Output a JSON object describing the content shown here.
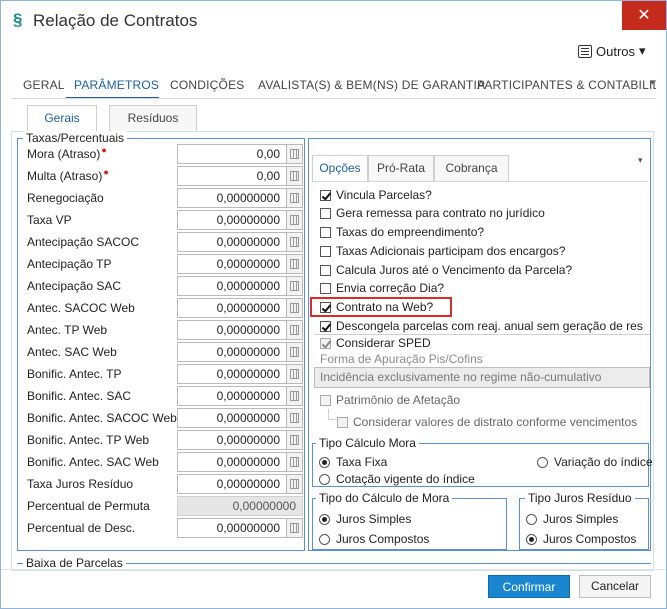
{
  "window": {
    "title": "Relação de Contratos",
    "close_glyph": "✕"
  },
  "toolbar": {
    "outros_label": "Outros",
    "outros_caret": "▾"
  },
  "main_tabs": [
    {
      "label": "GERAL"
    },
    {
      "label": "PARÂMETROS"
    },
    {
      "label": "CONDIÇÕES"
    },
    {
      "label": "AVALISTA(S) & BEM(NS) DE GARANTIA"
    },
    {
      "label": "PARTICIPANTES & CONTABILIDADE"
    }
  ],
  "sub_tabs": [
    {
      "label": "Gerais"
    },
    {
      "label": "Resíduos"
    }
  ],
  "taxas": {
    "legend": "Taxas/Percentuais",
    "fields": [
      {
        "label": "Mora (Atraso)",
        "required": true,
        "value": "0,00"
      },
      {
        "label": "Multa (Atraso)",
        "required": true,
        "value": "0,00"
      },
      {
        "label": "Renegociação",
        "value": "0,00000000"
      },
      {
        "label": "Taxa VP",
        "value": "0,00000000"
      },
      {
        "label": "Antecipação SACOC",
        "value": "0,00000000"
      },
      {
        "label": "Antecipação TP",
        "value": "0,00000000"
      },
      {
        "label": "Antecipação SAC",
        "value": "0,00000000"
      },
      {
        "label": "Antec. SACOC Web",
        "value": "0,00000000"
      },
      {
        "label": "Antec. TP Web",
        "value": "0,00000000"
      },
      {
        "label": "Antec. SAC Web",
        "value": "0,00000000"
      },
      {
        "label": "Bonific. Antec. TP",
        "value": "0,00000000"
      },
      {
        "label": "Bonific. Antec. SAC",
        "value": "0,00000000"
      },
      {
        "label": "Bonific. Antec. SACOC Web",
        "value": "0,00000000"
      },
      {
        "label": "Bonific. Antec. TP Web",
        "value": "0,00000000"
      },
      {
        "label": "Bonific. Antec. SAC Web",
        "value": "0,00000000"
      },
      {
        "label": "Taxa Juros Resíduo",
        "value": "0,00000000"
      },
      {
        "label": "Percentual de Permuta",
        "value": "0,00000000"
      },
      {
        "label": "Percentual de Desc.",
        "value": "0,00000000"
      }
    ]
  },
  "baixa_legend": "Baixa de Parcelas",
  "opt_tabs": [
    {
      "label": "Opções"
    },
    {
      "label": "Pró-Rata"
    },
    {
      "label": "Cobrança"
    }
  ],
  "options": [
    {
      "label": "Vincula Parcelas?",
      "checked": true
    },
    {
      "label": "Gera remessa para contrato no jurídico",
      "checked": false
    },
    {
      "label": "Taxas do empreendimento?",
      "checked": false
    },
    {
      "label": "Taxas Adicionais participam dos encargos?",
      "checked": false
    },
    {
      "label": "Calcula Juros até o Vencimento da Parcela?",
      "checked": false
    },
    {
      "label": "Envia correção Dia?",
      "checked": false
    },
    {
      "label": "Contrato na Web?",
      "checked": true
    },
    {
      "label": "Descongela parcelas com reaj. anual sem geração de res",
      "checked": true
    }
  ],
  "sped": {
    "label": "Considerar SPED",
    "forma_label": "Forma de Apuração Pis/Cofins",
    "forma_value": "Incidência exclusivamente no regime não-cumulativo",
    "patrimonio_label": "Patrimônio de Afetação",
    "distrato_label": "Considerar valores de distrato conforme vencimentos"
  },
  "tipo_calculo_mora": {
    "legend": "Tipo Cálculo Mora",
    "options": [
      "Taxa Fixa",
      "Variação do índice",
      "Cotação vigente do índice"
    ],
    "selected": "Taxa Fixa"
  },
  "tipo_do_calculo_mora": {
    "legend": "Tipo do Cálculo de Mora",
    "options": [
      "Juros Simples",
      "Juros Compostos"
    ],
    "selected": "Juros Simples"
  },
  "tipo_juros_residuo": {
    "legend": "Tipo Juros Resíduo",
    "options": [
      "Juros Simples",
      "Juros Compostos"
    ],
    "selected": "Juros Compostos"
  },
  "actions": {
    "confirm": "Confirmar",
    "cancel": "Cancelar"
  },
  "colors": {
    "accent": "#1d5fa5",
    "primary_button": "#1a86d0",
    "close_button": "#c42b1c",
    "highlight": "#d82b2b"
  }
}
